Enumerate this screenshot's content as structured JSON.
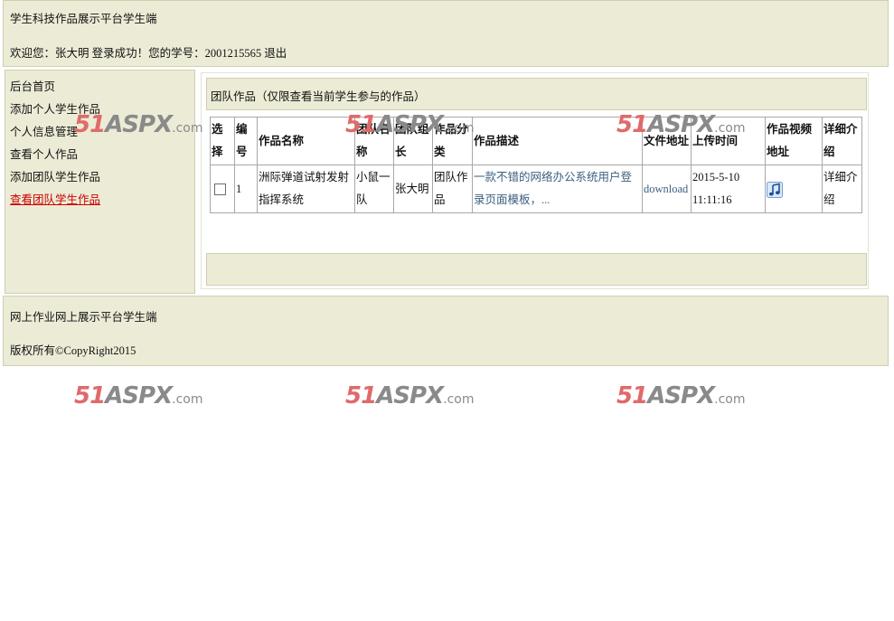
{
  "header": {
    "title": "学生科技作品展示平台学生端",
    "welcome_prefix": "欢迎您：张大明 登录成功！您的学号：2001215565",
    "logout_label": "退出"
  },
  "sidebar": {
    "items": [
      {
        "label": "后台首页"
      },
      {
        "label": "添加个人学生作品"
      },
      {
        "label": "个人信息管理"
      },
      {
        "label": "查看个人作品"
      },
      {
        "label": "添加团队学生作品"
      },
      {
        "label": "查看团队学生作品",
        "active": true
      }
    ]
  },
  "main": {
    "section_title": "团队作品（仅限查看当前学生参与的作品）",
    "table": {
      "headers": [
        "选择",
        "编号",
        "作品名称",
        "团队名称",
        "团队组长",
        "作品分类",
        "作品描述",
        "文件地址",
        "上传时间",
        "作品视频地址",
        "详细介绍"
      ],
      "rows": [
        {
          "id": "1",
          "name": "洲际弹道试射发射指挥系统",
          "team": "小鼠一队",
          "leader": "张大明",
          "category": "团队作品",
          "description": "一款不错的网络办公系统用户登录页面模板，...",
          "file": "download",
          "upload_time": "2015-5-10 11:11:16",
          "video_icon": "music-note-icon",
          "detail": "详细介绍"
        }
      ]
    }
  },
  "footer": {
    "line1": "网上作业网上展示平台学生端",
    "line2": "版权所有©CopyRight2015"
  },
  "watermark": {
    "number": "51",
    "brand": "ASPX",
    "domain": ".com",
    "colors": {
      "number": "#e06a6a",
      "brand": "#8a8a8a"
    }
  },
  "colors": {
    "panel_bg": "#ecebd6",
    "active_link": "#cc0000",
    "link": "#3c5f80"
  }
}
